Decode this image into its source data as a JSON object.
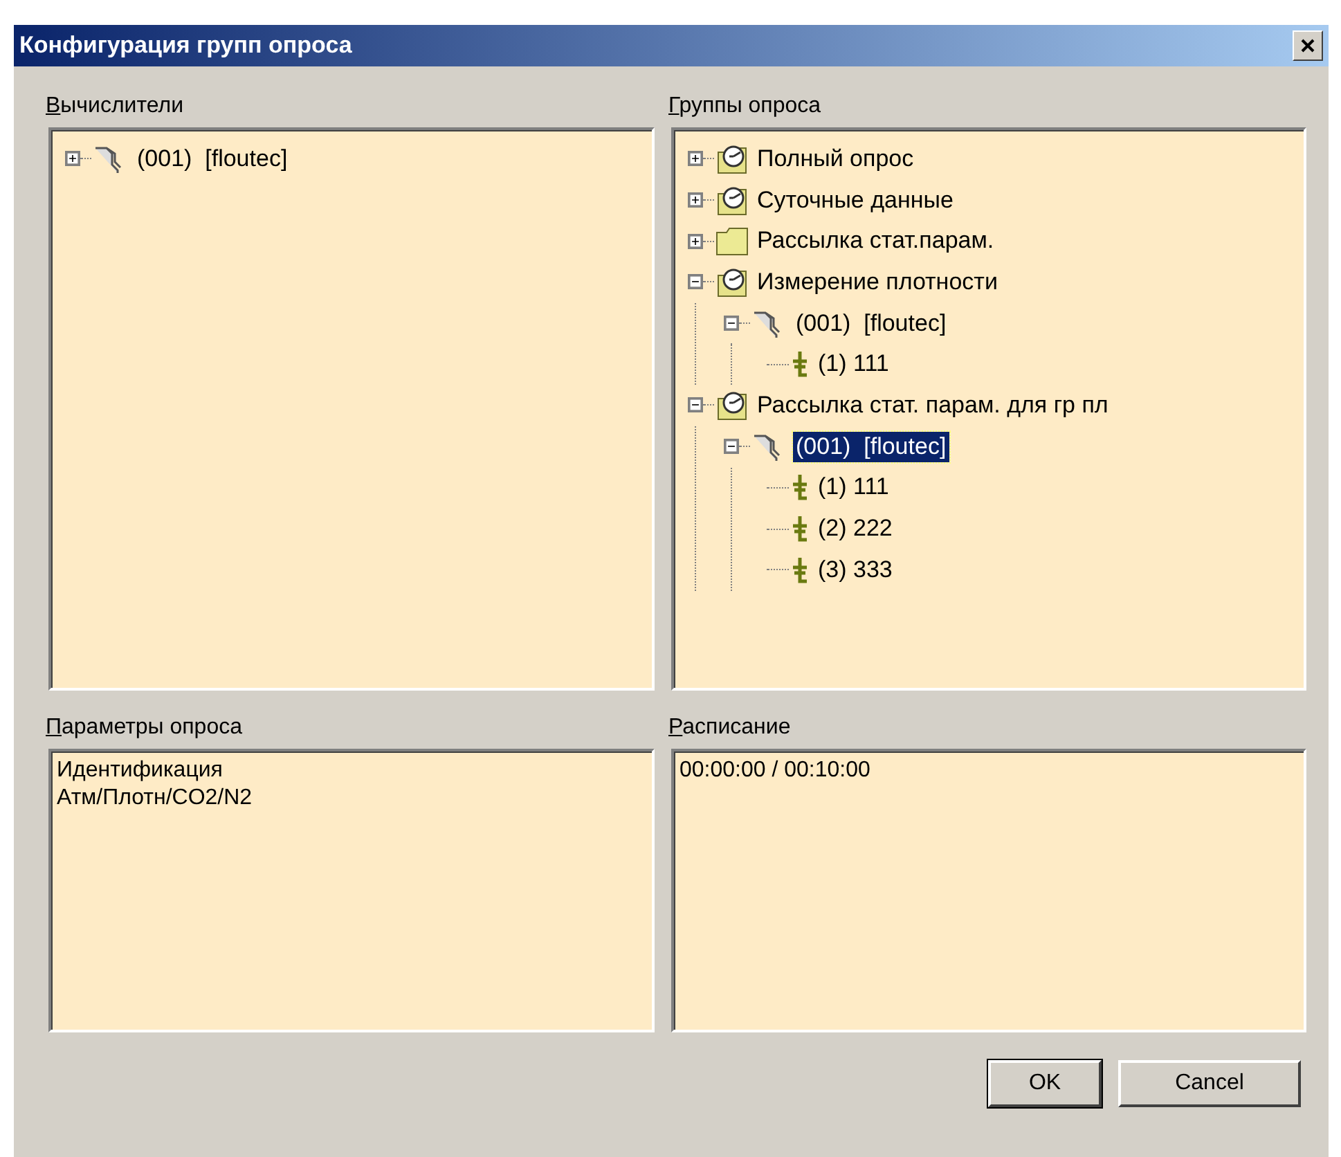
{
  "window": {
    "title": "Конфигурация групп опроса"
  },
  "computers": {
    "label": "Вычислители",
    "mnemonic": true,
    "tree": [
      {
        "kind": "device",
        "label": "(001)  [floutec]",
        "expanded": false,
        "selected": false
      }
    ]
  },
  "groups": {
    "label": "Группы опроса",
    "mnemonic": true,
    "tree": [
      {
        "kind": "group",
        "label": "Полный опрос",
        "expanded": false,
        "selected": false
      },
      {
        "kind": "group",
        "label": "Суточные данные",
        "expanded": false,
        "selected": false
      },
      {
        "kind": "folder",
        "label": "Рассылка стат.парам.",
        "expanded": false,
        "selected": false
      },
      {
        "kind": "group",
        "label": "Измерение плотности",
        "expanded": true,
        "selected": false,
        "children": [
          {
            "kind": "device",
            "label": "(001)  [floutec]",
            "expanded": true,
            "selected": false,
            "children": [
              {
                "kind": "param",
                "label": "(1) 111",
                "selected": false
              }
            ]
          }
        ]
      },
      {
        "kind": "group",
        "label": "Рассылка стат. парам. для гр пл",
        "expanded": true,
        "selected": false,
        "children": [
          {
            "kind": "device",
            "label": "(001)  [floutec]",
            "expanded": true,
            "selected": true,
            "children": [
              {
                "kind": "param",
                "label": "(1) 111",
                "selected": false
              },
              {
                "kind": "param",
                "label": "(2) 222",
                "selected": false
              },
              {
                "kind": "param",
                "label": "(3) 333",
                "selected": false
              }
            ]
          }
        ]
      }
    ]
  },
  "params": {
    "label": "Параметры опроса",
    "mnemonic": true,
    "lines": [
      "Идентификация",
      "Атм/Плотн/CO2/N2"
    ]
  },
  "schedule": {
    "label": "Расписание",
    "mnemonic": true,
    "lines": [
      "00:00:00 / 00:10:00"
    ]
  },
  "buttons": [
    {
      "label": "OK",
      "default": true
    },
    {
      "label": "Cancel",
      "default": false
    }
  ]
}
